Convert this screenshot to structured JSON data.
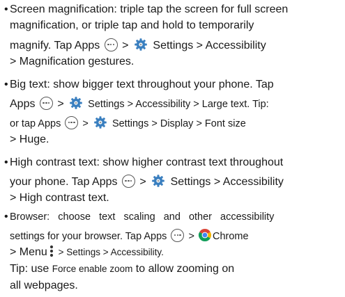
{
  "items": [
    {
      "lines": [
        {
          "segments": [
            {
              "text": "Screen magnification: triple tap the screen for full screen"
            }
          ]
        },
        {
          "segments": [
            {
              "text": "magnification, or triple tap and hold to temporarily"
            }
          ]
        },
        {
          "segments": [
            {
              "text": "magnify. Tap Apps "
            },
            {
              "icon": "apps-icon"
            },
            {
              "text": " > "
            },
            {
              "icon": "gear-icon"
            },
            {
              "text": " Settings > Accessibility"
            }
          ]
        },
        {
          "segments": [
            {
              "text": "> Magnification gestures."
            }
          ]
        }
      ]
    },
    {
      "lines": [
        {
          "segments": [
            {
              "text": "Big text: show bigger text throughout your phone. Tap"
            }
          ]
        },
        {
          "segments": [
            {
              "text": "Apps "
            },
            {
              "icon": "apps-icon"
            },
            {
              "text": " > "
            },
            {
              "icon": "gear-icon"
            },
            {
              "text": " Settings > Accessibility > Large text. Tip:"
            }
          ]
        },
        {
          "segments": [
            {
              "text": "or tap Apps "
            },
            {
              "icon": "apps-icon"
            },
            {
              "text": " > "
            },
            {
              "icon": "gear-icon"
            },
            {
              "text": " Settings > Display > Font size"
            }
          ]
        },
        {
          "segments": [
            {
              "text": "> Huge."
            }
          ]
        }
      ]
    },
    {
      "lines": [
        {
          "segments": [
            {
              "text": "High contrast text: show higher contrast text throughout"
            }
          ]
        },
        {
          "segments": [
            {
              "text": "your phone. Tap Apps "
            },
            {
              "icon": "apps-icon"
            },
            {
              "text": " > "
            },
            {
              "icon": "gear-icon"
            },
            {
              "text": " Settings > Accessibility"
            }
          ]
        },
        {
          "segments": [
            {
              "text": "> High contrast text."
            }
          ]
        }
      ]
    },
    {
      "lines": [
        {
          "segments": [
            {
              "text": "Browser:  choose  text  scaling  and  other  accessibility"
            }
          ]
        },
        {
          "segments": [
            {
              "text": "settings for your browser. Tap Apps "
            },
            {
              "icon": "apps-icon"
            },
            {
              "text": " > "
            },
            {
              "icon": "chrome-icon"
            },
            {
              "text": "Chrome"
            }
          ]
        },
        {
          "segments": [
            {
              "text": "> Menu"
            },
            {
              "icon": "menu-icon"
            },
            {
              "text": " > Settings > Accessibility."
            }
          ]
        },
        {
          "segments": [
            {
              "text": "Tip: use "
            },
            {
              "text": "Force enable zoom"
            },
            {
              "text": " to allow zooming on"
            }
          ]
        },
        {
          "segments": [
            {
              "text": "all webpages."
            }
          ]
        }
      ]
    }
  ],
  "bullet_glyph": "•",
  "colors": {
    "text": "#1a1a1a",
    "icon_gray": "#555555",
    "gear_blue": "#3a7fbf"
  }
}
